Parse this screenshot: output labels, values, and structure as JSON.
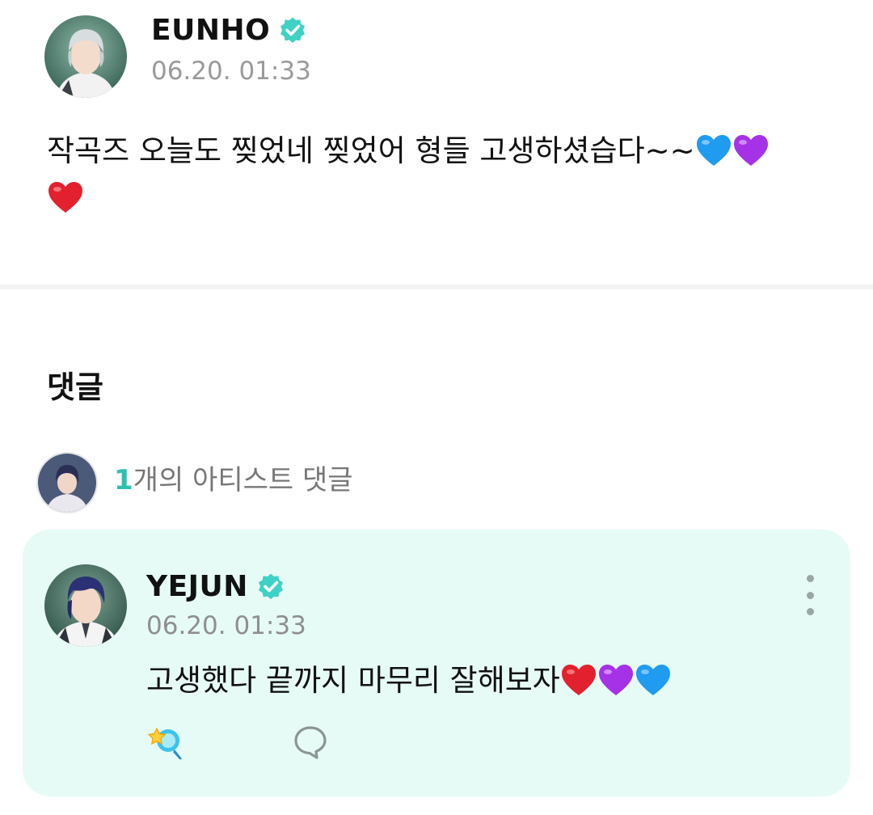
{
  "post": {
    "author": "EUNHO",
    "verified": true,
    "timestamp": "06.20. 01:33",
    "text": "작곡즈 오늘도 찢었네 찢었어 형들 고생하셨습다~~",
    "emojis": [
      "blue-heart",
      "purple-heart",
      "red-heart"
    ]
  },
  "comments_section": {
    "title": "댓글",
    "artist_summary": {
      "count": "1",
      "label": "개의 아티스트 댓글"
    }
  },
  "comment": {
    "author": "YEJUN",
    "verified": true,
    "timestamp": "06.20. 01:33",
    "text": "고생했다 끝까지 마무리 잘해보자",
    "emojis": [
      "red-heart",
      "purple-heart",
      "blue-heart"
    ],
    "actions": [
      "reaction-icon",
      "reply-bubble-icon",
      "more-options-icon"
    ]
  },
  "colors": {
    "accent": "#2ebfae",
    "verified": "#3fd1c5",
    "card_background": "#e6fbf6",
    "timestamp": "#9a9a9a"
  }
}
